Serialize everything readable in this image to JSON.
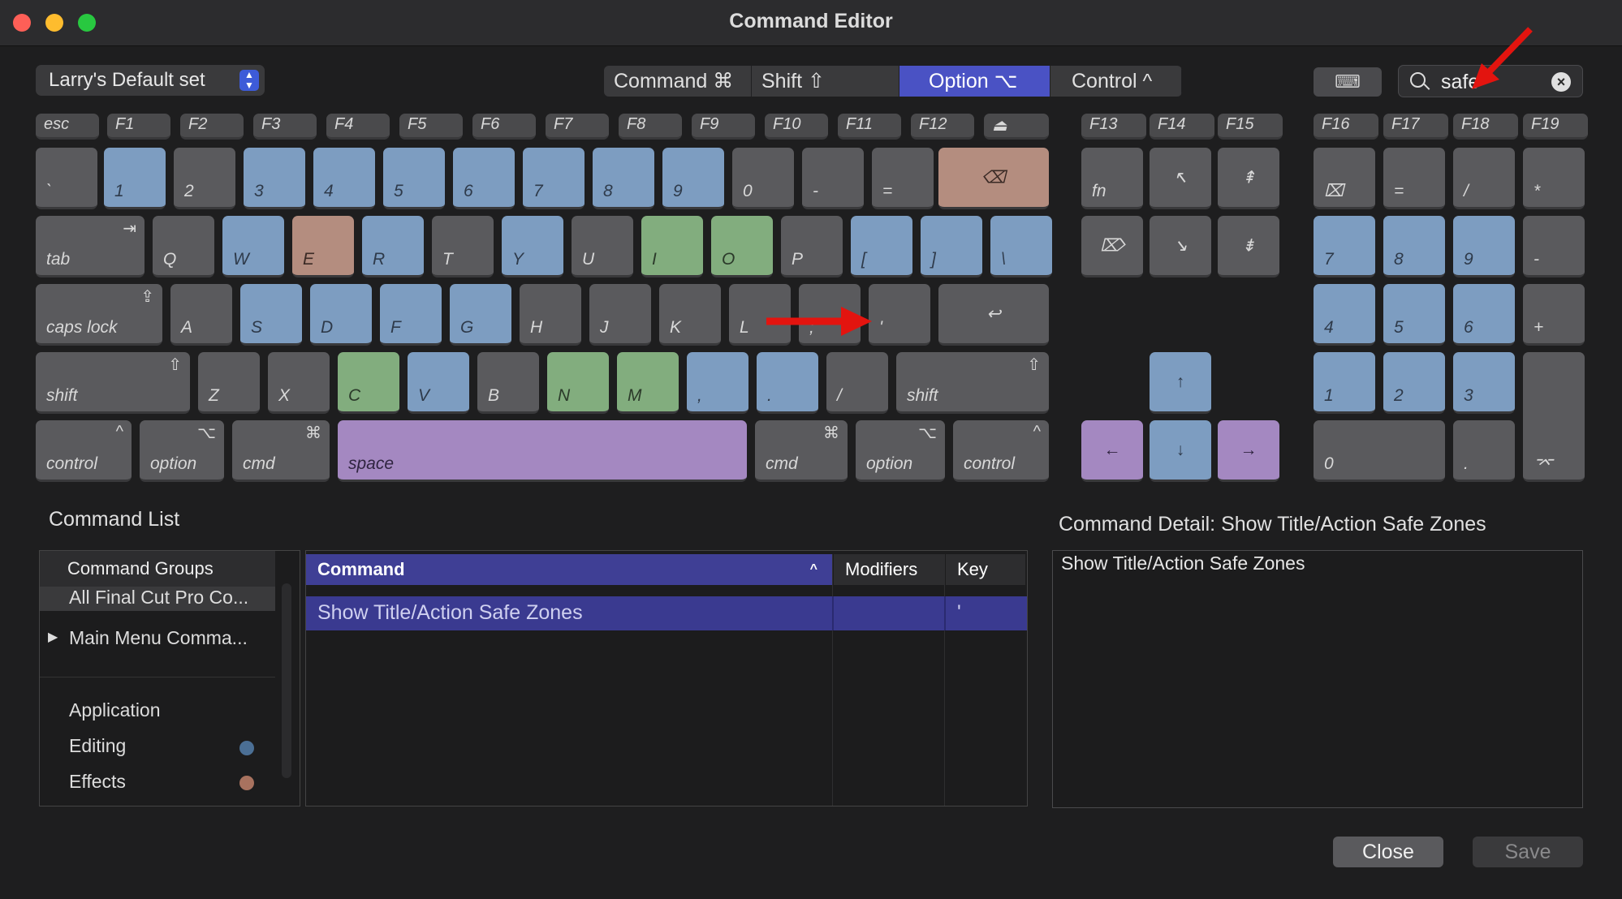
{
  "window": {
    "title": "Command Editor"
  },
  "command_set": {
    "label": "Larry's Default set"
  },
  "modifiers": [
    {
      "label": "Command ⌘",
      "selected": false
    },
    {
      "label": "Shift ⇧",
      "selected": false
    },
    {
      "label": "Option ⌥",
      "selected": true
    },
    {
      "label": "Control ^",
      "selected": false
    }
  ],
  "keyboard_button": {
    "icon": "keyboard-icon",
    "glyph": "⌨"
  },
  "search": {
    "value": "safe",
    "clear_glyph": "×"
  },
  "keyboard": {
    "function_row": [
      "esc",
      "F1",
      "F2",
      "F3",
      "F4",
      "F5",
      "F6",
      "F7",
      "F8",
      "F9",
      "F10",
      "F11",
      "F12",
      "⏏"
    ],
    "function_row_nav": [
      "F13",
      "F14",
      "F15"
    ],
    "function_row_num": [
      "F16",
      "F17",
      "F18",
      "F19"
    ],
    "number_row": [
      "`",
      "1",
      "2",
      "3",
      "4",
      "5",
      "6",
      "7",
      "8",
      "9",
      "0",
      "-",
      "=",
      "⌫"
    ],
    "q_row": [
      "tab",
      "Q",
      "W",
      "E",
      "R",
      "T",
      "Y",
      "U",
      "I",
      "O",
      "P",
      "[",
      "]",
      "\\"
    ],
    "a_row": [
      "caps lock",
      "A",
      "S",
      "D",
      "F",
      "G",
      "H",
      "J",
      "K",
      "L",
      ";",
      "'",
      "↩"
    ],
    "z_row": [
      "shift",
      "Z",
      "X",
      "C",
      "V",
      "B",
      "N",
      "M",
      ",",
      ".",
      "/",
      "shift"
    ],
    "bottom_row": [
      "control",
      "option",
      "cmd",
      "space",
      "cmd",
      "option",
      "control"
    ],
    "nav_keys": [
      "fn",
      "↖",
      "⇞",
      "⌦",
      "↘",
      "⇟",
      "↑",
      "←",
      "↓",
      "→"
    ],
    "numpad": [
      "⌧",
      "=",
      "/",
      "*",
      "7",
      "8",
      "9",
      "-",
      "4",
      "5",
      "6",
      "+",
      "1",
      "2",
      "3",
      "0",
      ".",
      "⌤"
    ],
    "key_symbols": {
      "tab": "⇥",
      "caps": "⇪",
      "shift": "⇧",
      "cmd": "⌘",
      "option": "⌥",
      "control": "^"
    }
  },
  "command_list": {
    "title": "Command List",
    "groups_header": "Command Groups",
    "groups": [
      "All Final Cut Pro Co...",
      "Main Menu Comma...",
      "Application",
      "Editing",
      "Effects"
    ],
    "group_colors": {
      "Editing": "#4b6f95",
      "Effects": "#a8725f"
    },
    "columns": [
      "Command",
      "Modifiers",
      "Key"
    ],
    "rows": [
      {
        "command": "Show Title/Action Safe Zones",
        "modifiers": "",
        "key": "'"
      }
    ]
  },
  "detail": {
    "title": "Command Detail: Show Title/Action Safe Zones",
    "body": "Show Title/Action Safe Zones"
  },
  "buttons": {
    "close": "Close",
    "save": "Save"
  },
  "colors": {
    "accent": "#4a52c4",
    "blue_key": "#7d9dc1",
    "green_key": "#82ad7e",
    "red_key": "#b48d7f",
    "purple_key": "#a488c1",
    "arrow": "#e3140f"
  }
}
